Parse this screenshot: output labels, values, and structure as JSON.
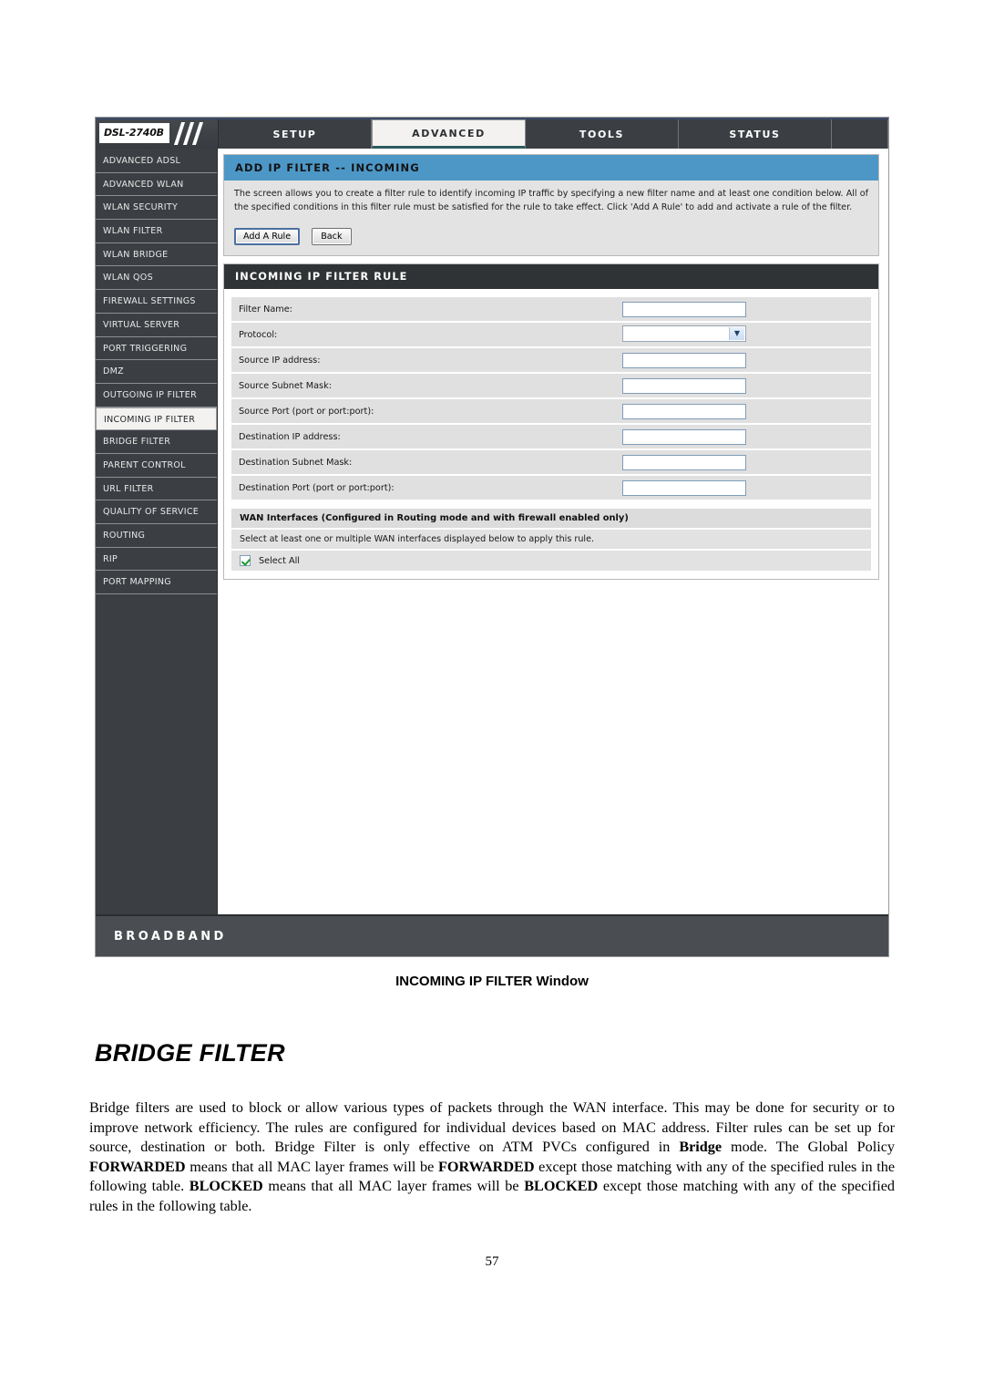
{
  "document": {
    "figure_caption": "INCOMING IP FILTER Window",
    "section_title": "BRIDGE FILTER",
    "body_paragraph": "Bridge filters are used to block or allow various types of packets through the WAN interface. This may be done for security or to improve network efficiency. The rules are configured for individual devices based on MAC address. Filter rules can be set up for source, destination or both. Bridge Filter is only effective on ATM PVCs configured in Bridge mode. The Global Policy FORWARDED means that all MAC layer frames will be FORWARDED except those matching with any of the specified rules in the following table. BLOCKED means that all MAC layer frames will be BLOCKED except those matching with any of the specified rules in the following table.",
    "page_number": "57"
  },
  "router": {
    "brand_model": "DSL-2740B",
    "footer_label": "BROADBAND",
    "nav_tabs": [
      {
        "label": "SETUP",
        "active": false
      },
      {
        "label": "ADVANCED",
        "active": true
      },
      {
        "label": "TOOLS",
        "active": false
      },
      {
        "label": "STATUS",
        "active": false
      }
    ],
    "sidebar": {
      "items": [
        {
          "label": "ADVANCED ADSL",
          "active": false
        },
        {
          "label": "ADVANCED WLAN",
          "active": false
        },
        {
          "label": "WLAN SECURITY",
          "active": false
        },
        {
          "label": "WLAN FILTER",
          "active": false
        },
        {
          "label": "WLAN BRIDGE",
          "active": false
        },
        {
          "label": "WLAN QOS",
          "active": false
        },
        {
          "label": "FIREWALL SETTINGS",
          "active": false
        },
        {
          "label": "VIRTUAL SERVER",
          "active": false
        },
        {
          "label": "PORT TRIGGERING",
          "active": false
        },
        {
          "label": "DMZ",
          "active": false
        },
        {
          "label": "OUTGOING IP FILTER",
          "active": false
        },
        {
          "label": "INCOMING IP FILTER",
          "active": true
        },
        {
          "label": "BRIDGE FILTER",
          "active": false
        },
        {
          "label": "PARENT CONTROL",
          "active": false
        },
        {
          "label": "URL FILTER",
          "active": false
        },
        {
          "label": "QUALITY OF SERVICE",
          "active": false
        },
        {
          "label": "ROUTING",
          "active": false
        },
        {
          "label": "RIP",
          "active": false
        },
        {
          "label": "PORT MAPPING",
          "active": false
        }
      ]
    },
    "intro_panel": {
      "title": "ADD IP FILTER -- INCOMING",
      "description": "The screen allows you to create a filter rule to identify incoming IP traffic by specifying a new filter name and at least one condition below. All of the specified conditions in this filter rule must be satisfied for the rule to take effect. Click 'Add A Rule' to add and activate a rule of the filter.",
      "add_rule_button": "Add A Rule",
      "back_button": "Back"
    },
    "rule_panel": {
      "title": "INCOMING IP FILTER RULE",
      "fields": [
        {
          "label": "Filter Name:",
          "type": "text",
          "value": ""
        },
        {
          "label": "Protocol:",
          "type": "select",
          "value": ""
        },
        {
          "label": "Source IP address:",
          "type": "text",
          "value": ""
        },
        {
          "label": "Source Subnet Mask:",
          "type": "text",
          "value": ""
        },
        {
          "label": "Source Port (port or port:port):",
          "type": "text",
          "value": ""
        },
        {
          "label": "Destination IP address:",
          "type": "text",
          "value": ""
        },
        {
          "label": "Destination Subnet Mask:",
          "type": "text",
          "value": ""
        },
        {
          "label": "Destination Port (port or port:port):",
          "type": "text",
          "value": ""
        }
      ]
    },
    "wan_section": {
      "title": "WAN Interfaces (Configured in Routing mode and with firewall enabled only)",
      "subtitle": "Select at least one or multiple WAN interfaces displayed below to apply this rule.",
      "select_all_label": "Select All",
      "select_all_checked": true
    },
    "colors": {
      "accent_blue": "#4d97c6",
      "dark_chrome": "#3b3f43",
      "panel_head_dark": "#2f3336",
      "footer_bg": "#4a4e52",
      "check_green": "#1a9b2e"
    }
  }
}
